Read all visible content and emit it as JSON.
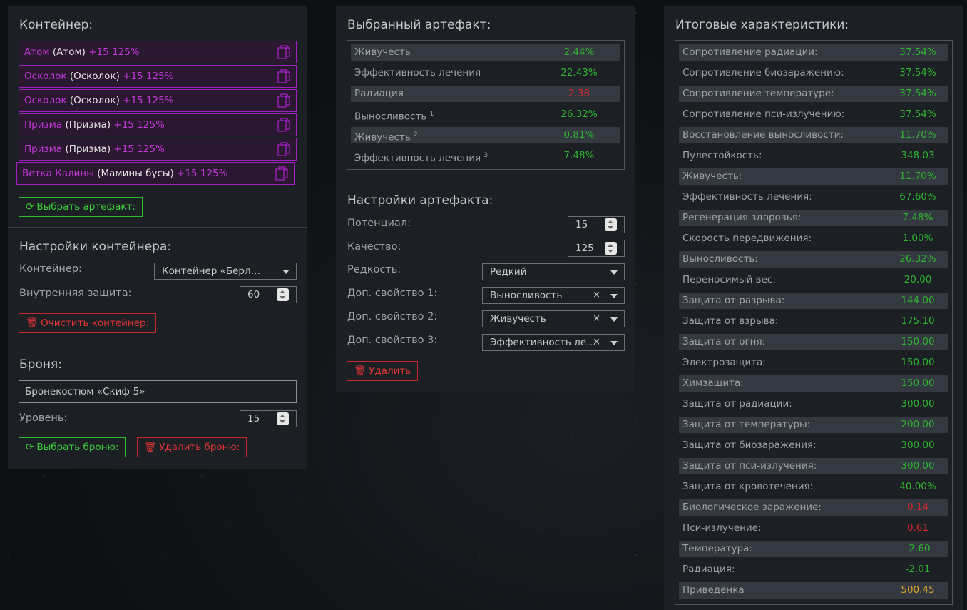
{
  "container_panel": {
    "title": "Контейнер:",
    "items": [
      {
        "name": "Атом",
        "sub": "(Атом)",
        "pct": "+15 125%"
      },
      {
        "name": "Осколок",
        "sub": "(Осколок)",
        "pct": "+15 125%"
      },
      {
        "name": "Осколок",
        "sub": "(Осколок)",
        "pct": "+15 125%"
      },
      {
        "name": "Призма",
        "sub": "(Призма)",
        "pct": "+15 125%"
      },
      {
        "name": "Призма",
        "sub": "(Призма)",
        "pct": "+15 125%"
      },
      {
        "name": "Ветка Калины",
        "sub": "(Мамины бусы)",
        "pct": "+15 125%"
      }
    ],
    "select_artifact_label": "Выбрать артефакт:",
    "settings_title": "Настройки контейнера:",
    "container_label": "Контейнер:",
    "container_value": "Контейнер «Берлога...",
    "inner_protection_label": "Внутренняя защита:",
    "inner_protection_value": "60",
    "clear_label": "Очистить контейнер:"
  },
  "armor_panel": {
    "title": "Броня:",
    "armor_value": "Бронекостюм «Скиф-5»",
    "level_label": "Уровень:",
    "level_value": "15",
    "select_armor_label": "Выбрать броню:",
    "delete_armor_label": "Удалить броню:"
  },
  "selected_artifact": {
    "title": "Выбранный артефакт:",
    "stats": [
      {
        "key": "Живучесть",
        "sup": "",
        "value": "2.44%",
        "color": "g"
      },
      {
        "key": "Эффективность лечения",
        "sup": "",
        "value": "22.43%",
        "color": "g"
      },
      {
        "key": "Радиация",
        "sup": "",
        "value": "2.38",
        "color": "r"
      },
      {
        "key": "Выносливость",
        "sup": "1",
        "value": "26.32%",
        "color": "g"
      },
      {
        "key": "Живучесть",
        "sup": "2",
        "value": "0.81%",
        "color": "g"
      },
      {
        "key": "Эффективность лечения",
        "sup": "3",
        "value": "7.48%",
        "color": "g"
      }
    ]
  },
  "artifact_settings": {
    "title": "Настройки артефакта:",
    "potential_label": "Потенциал:",
    "potential_value": "15",
    "quality_label": "Качество:",
    "quality_value": "125",
    "rarity_label": "Редкость:",
    "rarity_value": "Редкий",
    "extra1_label": "Доп. свойство 1:",
    "extra1_value": "Выносливость",
    "extra2_label": "Доп. свойство 2:",
    "extra2_value": "Живучесть",
    "extra3_label": "Доп. свойство 3:",
    "extra3_value": "Эффективность лечения",
    "clear_mark": "×",
    "delete_label": "Удалить"
  },
  "totals": {
    "title": "Итоговые характеристики:",
    "stats": [
      {
        "key": "Сопротивление радиации:",
        "value": "37.54%",
        "color": "g"
      },
      {
        "key": "Сопротивление биозаражению:",
        "value": "37.54%",
        "color": "g"
      },
      {
        "key": "Сопротивление температуре:",
        "value": "37.54%",
        "color": "g"
      },
      {
        "key": "Сопротивление пси-излучению:",
        "value": "37.54%",
        "color": "g"
      },
      {
        "key": "Восстановление выносливости:",
        "value": "11.70%",
        "color": "g"
      },
      {
        "key": "Пулестойкость:",
        "value": "348.03",
        "color": "g"
      },
      {
        "key": "Живучесть:",
        "value": "11.70%",
        "color": "g"
      },
      {
        "key": "Эффективность лечения:",
        "value": "67.60%",
        "color": "g"
      },
      {
        "key": "Регенерация здоровья:",
        "value": "7.48%",
        "color": "g"
      },
      {
        "key": "Скорость передвижения:",
        "value": "1.00%",
        "color": "g"
      },
      {
        "key": "Выносливость:",
        "value": "26.32%",
        "color": "g"
      },
      {
        "key": "Переносимый вес:",
        "value": "20.00",
        "color": "g"
      },
      {
        "key": "Защита от разрыва:",
        "value": "144.00",
        "color": "g"
      },
      {
        "key": "Защита от взрыва:",
        "value": "175.10",
        "color": "g"
      },
      {
        "key": "Защита от огня:",
        "value": "150.00",
        "color": "g"
      },
      {
        "key": "Электрозащита:",
        "value": "150.00",
        "color": "g"
      },
      {
        "key": "Химзащита:",
        "value": "150.00",
        "color": "g"
      },
      {
        "key": "Защита от радиации:",
        "value": "300.00",
        "color": "g"
      },
      {
        "key": "Защита от температуры:",
        "value": "200.00",
        "color": "g"
      },
      {
        "key": "Защита от биозаражения:",
        "value": "300.00",
        "color": "g"
      },
      {
        "key": "Защита от пси-излучения:",
        "value": "300.00",
        "color": "g"
      },
      {
        "key": "Защита от кровотечения:",
        "value": "40.00%",
        "color": "g"
      },
      {
        "key": "Биологическое заражение:",
        "value": "0.14",
        "color": "r"
      },
      {
        "key": "Пси-излучение:",
        "value": "0.61",
        "color": "r"
      },
      {
        "key": "Температура:",
        "value": "-2.60",
        "color": "g"
      },
      {
        "key": "Радиация:",
        "value": "-2.01",
        "color": "g"
      },
      {
        "key": "Приведёнка",
        "value": "500.45",
        "color": "y"
      }
    ]
  }
}
